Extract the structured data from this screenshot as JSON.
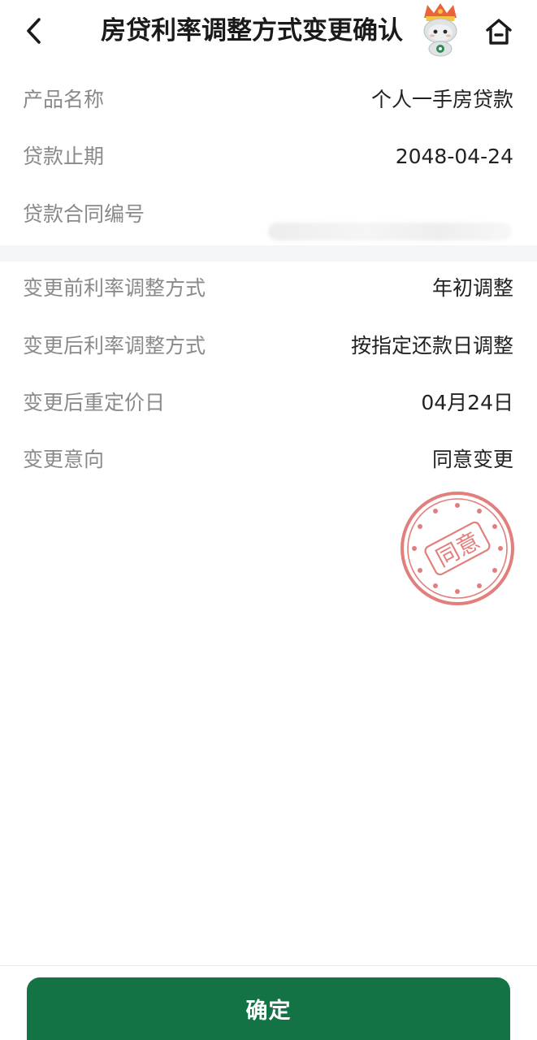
{
  "header": {
    "title": "房贷利率调整方式变更确认",
    "back_icon": "chevron-left-icon",
    "home_icon": "home-icon",
    "mascot_icon": "mascot-icon"
  },
  "loan_info": [
    {
      "label": "产品名称",
      "value": "个人一手房贷款"
    },
    {
      "label": "贷款止期",
      "value": "2048-04-24"
    },
    {
      "label": "贷款合同编号",
      "value": ""
    }
  ],
  "change_info": [
    {
      "label": "变更前利率调整方式",
      "value": "年初调整"
    },
    {
      "label": "变更后利率调整方式",
      "value": "按指定还款日调整"
    },
    {
      "label": "变更后重定价日",
      "value": "04月24日"
    },
    {
      "label": "变更意向",
      "value": "同意变更"
    }
  ],
  "stamp": {
    "text": "同意",
    "color": "#d9534f"
  },
  "footer": {
    "confirm_label": "确定"
  },
  "colors": {
    "primary_green": "#137344",
    "label_gray": "#8a8a8a",
    "value_dark": "#222222",
    "divider_bg": "#f4f5f7"
  }
}
